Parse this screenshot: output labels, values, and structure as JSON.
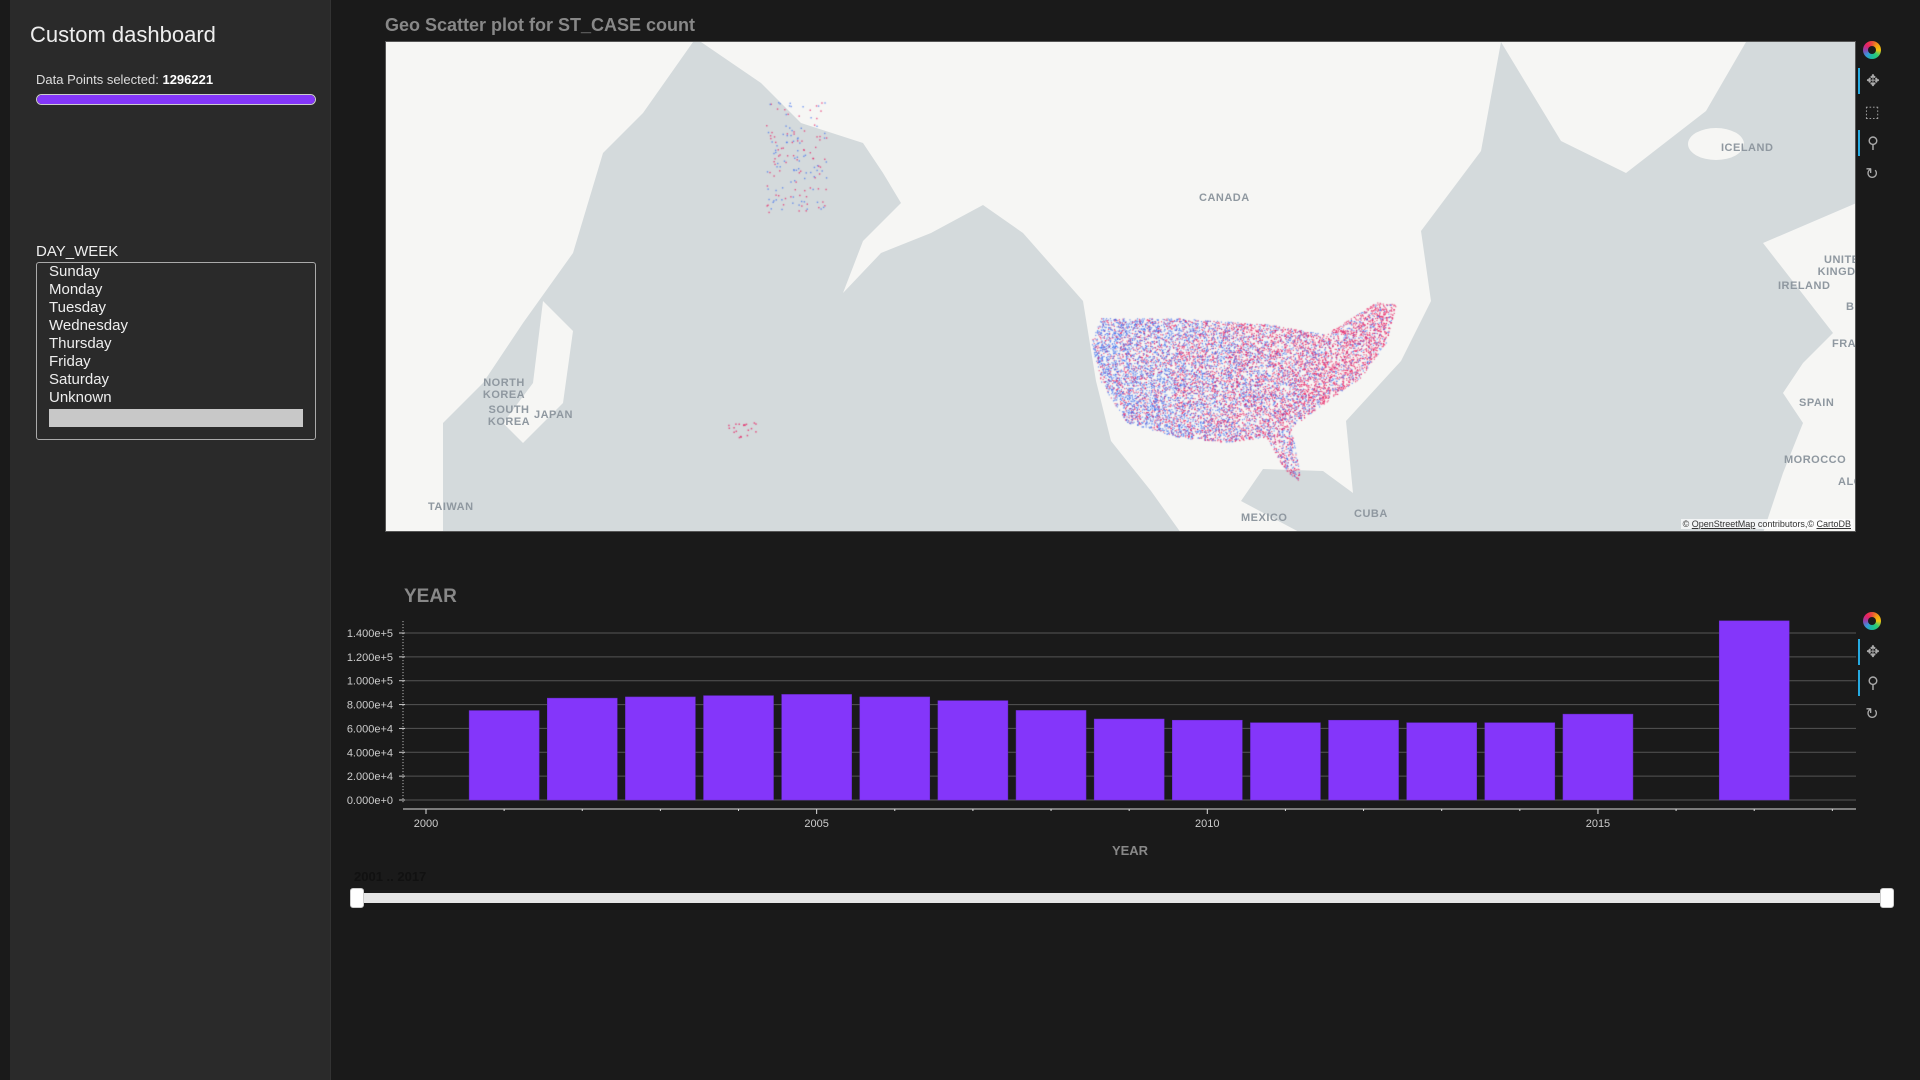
{
  "sidebar": {
    "title": "Custom dashboard",
    "data_points_label": "Data Points selected: ",
    "data_points_value": "1296221",
    "progress_fraction": 1.0,
    "day_week_label": "DAY_WEEK",
    "day_week_options": [
      "Sunday",
      "Monday",
      "Tuesday",
      "Wednesday",
      "Thursday",
      "Friday",
      "Saturday",
      "Unknown",
      ""
    ]
  },
  "map": {
    "title": "Geo Scatter plot for ST_CASE count",
    "labels": [
      "CANADA",
      "MEXICO",
      "CUBA",
      "ICELAND",
      "UNITED KINGDOM",
      "IRELAND",
      "BELG",
      "FRANCE",
      "SPAIN",
      "MOROCCO",
      "ALGER",
      "NORTH KOREA",
      "SOUTH KOREA",
      "JAPAN",
      "TAIWAN"
    ],
    "attribution": {
      "prefix": "© ",
      "osm": "OpenStreetMap",
      "mid": " contributors,© ",
      "carto": "CartoDB"
    },
    "colors": {
      "ocean": "#d4dadc",
      "land": "#f6f6f4",
      "points_low": "#3a6df0",
      "points_high": "#e8175d"
    },
    "toolbar": [
      "bokeh-logo-icon",
      "pan-icon",
      "box-zoom-icon",
      "wheel-zoom-icon",
      "reset-icon"
    ]
  },
  "chart_data": {
    "type": "bar",
    "title": "YEAR",
    "xlabel": "YEAR",
    "ylabel": "",
    "x": [
      2001,
      2002,
      2003,
      2004,
      2005,
      2006,
      2007,
      2008,
      2009,
      2010,
      2011,
      2012,
      2013,
      2014,
      2015,
      2017
    ],
    "values": [
      75000,
      85400,
      86400,
      87500,
      88500,
      86400,
      83300,
      75100,
      67900,
      66900,
      64800,
      66900,
      64800,
      64800,
      72000,
      150200
    ],
    "xlim": [
      1999.7,
      2018.3
    ],
    "ylim": [
      -3000,
      150200
    ],
    "yticks": [
      "0.000e+0",
      "2.000e+4",
      "4.000e+4",
      "6.000e+4",
      "8.000e+4",
      "1.000e+5",
      "1.200e+5",
      "1.400e+5"
    ],
    "xticks": [
      "2000",
      "2005",
      "2010",
      "2015"
    ],
    "grid": true,
    "color": "#8436fa",
    "toolbar": [
      "bokeh-logo-icon",
      "pan-icon",
      "wheel-zoom-icon",
      "reset-icon"
    ]
  },
  "slider": {
    "label": "2001 .. 2017",
    "start": 2001,
    "end": 2017
  }
}
